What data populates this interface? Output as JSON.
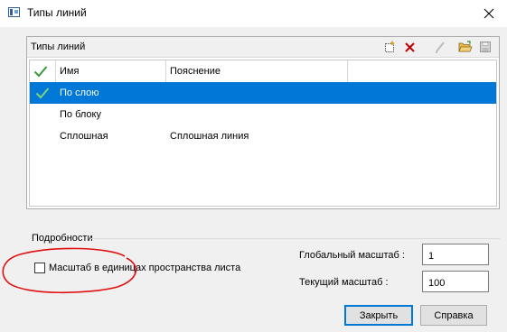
{
  "window": {
    "title": "Типы линий",
    "close_glyph": "✕"
  },
  "linetypes": {
    "caption": "Типы линий",
    "toolbar": [
      {
        "name": "new-icon",
        "enabled": true
      },
      {
        "name": "delete-icon",
        "enabled": true
      },
      {
        "name": "edit-icon",
        "enabled": false
      },
      {
        "name": "open-folder-icon",
        "enabled": true
      },
      {
        "name": "save-icon",
        "enabled": false
      }
    ],
    "columns": [
      "Имя",
      "Пояснение"
    ],
    "header_check": "✔",
    "rows": [
      {
        "name": "По слою",
        "description": "",
        "current": true,
        "selected": true
      },
      {
        "name": "По блоку",
        "description": "",
        "current": false,
        "selected": false
      },
      {
        "name": "Сплошная",
        "description": "Сплошная линия",
        "current": false,
        "selected": false
      }
    ],
    "current_mark": "✔"
  },
  "details": {
    "label": "Подробности",
    "paper_space_checkbox": {
      "label": "Масштаб в единицах пространства листа",
      "checked": false
    },
    "global_scale": {
      "label": "Глобальный масштаб :",
      "value": "1"
    },
    "current_scale": {
      "label": "Текущий масштаб :",
      "value": "100"
    }
  },
  "buttons": {
    "close": "Закрыть",
    "help": "Справка"
  },
  "colors": {
    "selection": "#0078d7",
    "check_green": "#3a9a3a",
    "annotation_red": "#e01010"
  }
}
